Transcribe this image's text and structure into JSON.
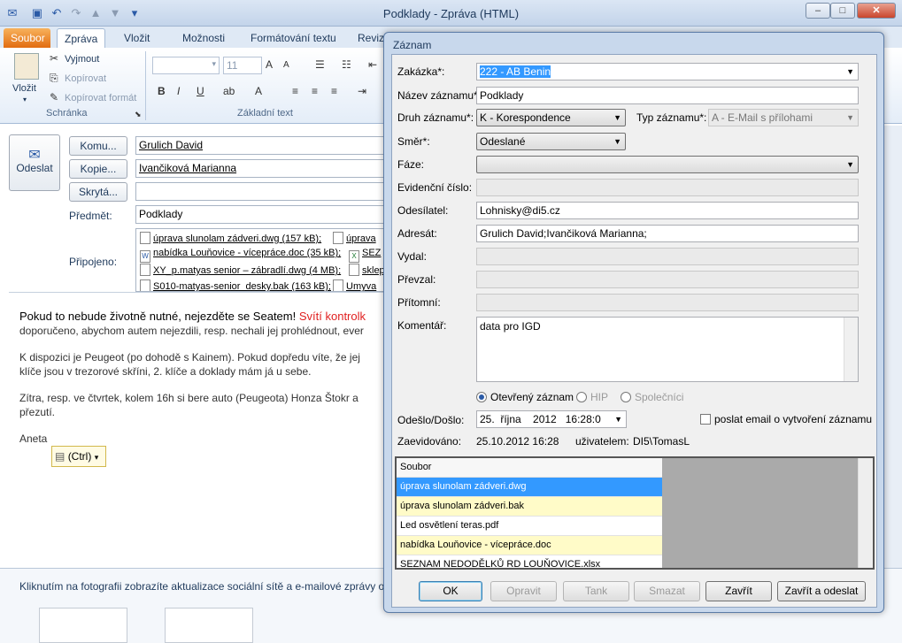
{
  "window": {
    "title": "Podklady - Zpráva (HTML)",
    "minimize": "–",
    "maximize": "□",
    "close": "✕"
  },
  "tabs": {
    "file": "Soubor",
    "message": "Zpráva",
    "insert": "Vložit",
    "options": "Možnosti",
    "format": "Formátování textu",
    "review": "Revize"
  },
  "ribbon": {
    "paste": "Vložit",
    "cut": "Vyjmout",
    "copy": "Kopírovat",
    "format_painter": "Kopírovat formát",
    "clipboard": "Schránka",
    "basic_text": "Základní text",
    "font_size": "11"
  },
  "compose": {
    "send": "Odeslat",
    "to_btn": "Komu...",
    "cc_btn": "Kopie...",
    "bcc_btn": "Skrytá...",
    "to_value": "Grulich David",
    "cc_value": "Ivančiková Marianna",
    "bcc_value": "",
    "subject_label": "Předmět:",
    "subject_value": "Podklady",
    "attached_label": "Připojeno:",
    "attachments": [
      {
        "name": "úprava slunolam zádveri.dwg (157 kB);",
        "cut": "úprava"
      },
      {
        "name": "nabídka Louňovice - vícepráce.doc (35 kB);",
        "cut": "SEZ"
      },
      {
        "name": "XY_p.matyas senior – zábradlí.dwg (4 MB);",
        "cut": "sklep"
      },
      {
        "name": "S010-matyas-senior_desky.bak (163 kB);",
        "cut": "Umyva"
      }
    ],
    "body": {
      "p1_bold": "Pokud to nebude životně nutné, nejezděte se Seatem!",
      "p1_red": "Svítí kontrolk",
      "p1_rest": "doporučeno, abychom autem nejezdili, resp. nechali jej prohlédnout, ever",
      "p2_a": "K dispozici je Peugeot (po dohodě s Kainem). Pokud dopředu víte, že jej",
      "p2_b": "klíče jsou v trezorové skříni, 2. klíče a doklady mám já u sebe.",
      "p3_a": "Zítra, resp. ve čtvrtek, kolem 16h si bere auto (Peugeota) Honza Štokr a",
      "p3_b": "přezutí.",
      "sign": "Aneta"
    },
    "paste_options": "(Ctrl)",
    "social": "Kliknutím na fotografii zobrazíte aktualizace sociální sítě a e-mailové zprávy od"
  },
  "dialog": {
    "title": "Záznam",
    "zakazka_label": "Zakázka*:",
    "zakazka_value": "222 - AB Benin",
    "nazev_label": "Název záznamu*:",
    "nazev_value": "Podklady",
    "druh_label": "Druh záznamu*:",
    "druh_value": "K - Korespondence",
    "typ_label": "Typ záznamu*:",
    "typ_value": "A - E-Mail s přílohami",
    "smer_label": "Směr*:",
    "smer_value": "Odeslané",
    "faze_label": "Fáze:",
    "faze_value": "",
    "evid_label": "Evidenční číslo:",
    "evid_value": "",
    "odes_label": "Odesílatel:",
    "odes_value": "Lohnisky@di5.cz",
    "adresat_label": "Adresát:",
    "adresat_value": "Grulich David;Ivančiková Marianna;",
    "vydal_label": "Vydal:",
    "prevzal_label": "Převzal:",
    "pritomni_label": "Přítomní:",
    "koment_label": "Komentář:",
    "koment_value": "data pro IGD",
    "radio_open": "Otevřený záznam",
    "radio_hip": "HIP",
    "radio_spol": "Společníci",
    "odeslo_label": "Odešlo/Došlo:",
    "odeslo_value": "25.  října    2012   16:28:0",
    "email_chk": "poslat email o vytvoření záznamu",
    "zaevid_label": "Zaevidováno:",
    "zaevid_value": "25.10.2012 16:28",
    "user_label": "uživatelem:",
    "user_value": "DI5\\TomasL",
    "files_header": "Soubor",
    "files": [
      "úprava slunolam zádveri.dwg",
      "úprava slunolam zádveri.bak",
      "Led osvětlení teras.pdf",
      "nabídka Louňovice - vícepráce.doc",
      "SEZNAM NEDODĚLKŮ RD LOUŇOVICE.xlsx"
    ],
    "btn_ok": "OK",
    "btn_open": "Opravit",
    "btn_delete": "Tank",
    "btn_clear": "Smazat",
    "btn_close": "Zavřít",
    "btn_close_send": "Zavřít a odeslat"
  }
}
